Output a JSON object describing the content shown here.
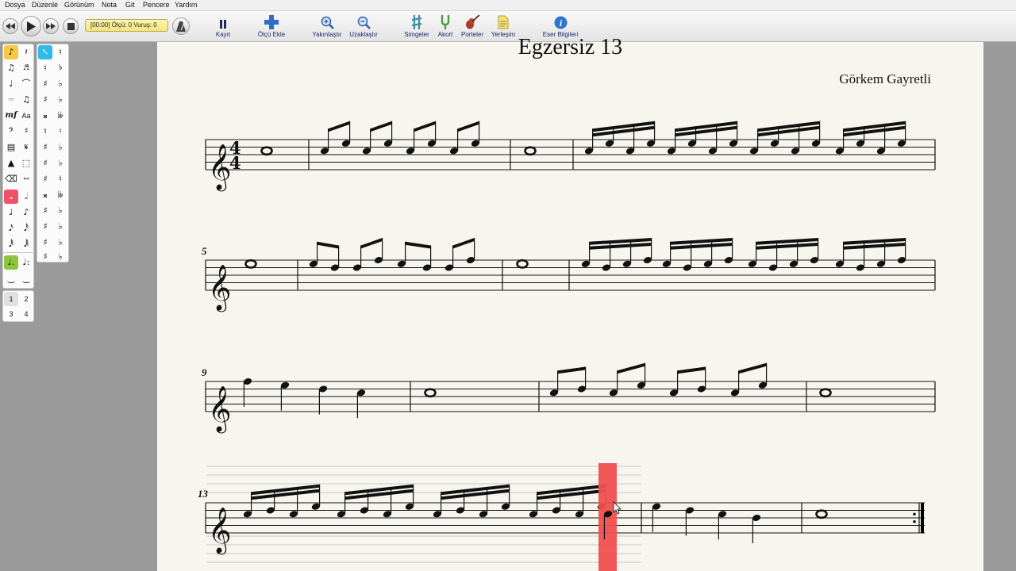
{
  "menu": [
    "Dosya",
    "Düzenle",
    "Görünüm",
    "Nota",
    "Git",
    "Pencere",
    "Yardım"
  ],
  "transport": {
    "counter": "[00:00]  Ölçü: 0  Vuruş: 0"
  },
  "toolbar": {
    "record": "Kayıt",
    "add_measure": "Ölçü Ekle",
    "zoom_in": "Yakınlaştır",
    "zoom_out": "Uzaklaştır",
    "symbols": "Simgeler",
    "chord": "Akort",
    "staves": "Porteler",
    "layout": "Yerleşim",
    "info": "Eser Bilgileri"
  },
  "palette": {
    "voices": [
      "1",
      "2",
      "3",
      "4"
    ],
    "dynamics": "mf",
    "text": "Aa"
  },
  "score": {
    "title": "Egzersiz 13",
    "composer": "Görkem Gayretli",
    "time_signature": [
      "4",
      "4"
    ],
    "measure_numbers": [
      "5",
      "9",
      "13"
    ]
  },
  "colors": {
    "menubar": "#f0f0f0",
    "page": "#f7f6ee",
    "background": "#9a9a9a",
    "playhead": "#f05050",
    "counter": "#f5e37c",
    "selected_tool_blue": "#33b8ea",
    "selected_tool_red": "#f0506a",
    "selected_tool_green": "#8cc63f"
  },
  "icons": [
    "rewind-icon",
    "play-icon",
    "fast-forward-icon",
    "stop-icon",
    "metronome-icon",
    "pause-icon",
    "plus-icon",
    "zoom-in-icon",
    "zoom-out-icon",
    "symbols-icon",
    "tuning-fork-icon",
    "violin-icon",
    "layout-icon",
    "info-icon"
  ]
}
